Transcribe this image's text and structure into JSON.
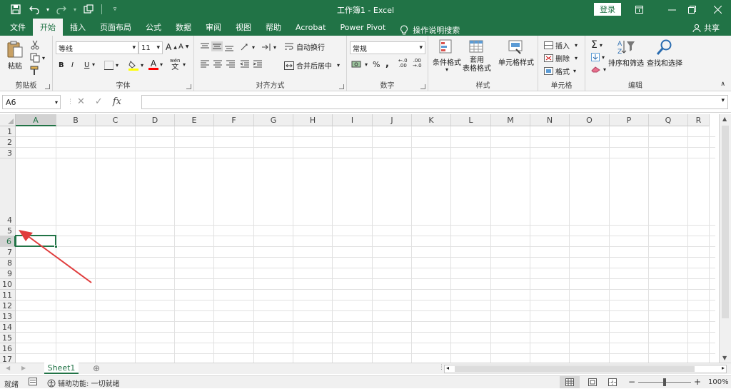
{
  "titlebar": {
    "title": "工作簿1 - Excel",
    "login_label": "登录",
    "bg_color": "#217346"
  },
  "tabs": [
    {
      "label": "文件"
    },
    {
      "label": "开始"
    },
    {
      "label": "插入"
    },
    {
      "label": "页面布局"
    },
    {
      "label": "公式"
    },
    {
      "label": "数据"
    },
    {
      "label": "审阅"
    },
    {
      "label": "视图"
    },
    {
      "label": "帮助"
    },
    {
      "label": "Acrobat"
    },
    {
      "label": "Power Pivot"
    }
  ],
  "tell_me": "操作说明搜索",
  "share_label": "共享",
  "ribbon": {
    "clipboard": {
      "paste": "粘贴",
      "group": "剪贴板"
    },
    "font": {
      "name": "等线",
      "size": "11",
      "group": "字体",
      "bold": "B",
      "italic": "I",
      "underline": "U",
      "font_color": "A",
      "wen": "wén",
      "wen_char": "文"
    },
    "alignment": {
      "wrap": "自动换行",
      "merge": "合并后居中",
      "group": "对齐方式"
    },
    "number": {
      "format": "常规",
      "percent": "%",
      "comma": ",",
      "group": "数字"
    },
    "styles": {
      "conditional": "条件格式",
      "table1": "套用",
      "table2": "表格格式",
      "cell_styles": "单元格样式",
      "group": "样式"
    },
    "cells": {
      "insert": "插入",
      "delete": "删除",
      "format": "格式",
      "group": "单元格"
    },
    "editing": {
      "sort": "排序和筛选",
      "find": "查找和选择",
      "group": "编辑",
      "sigma": "Σ"
    }
  },
  "formula_bar": {
    "name_box": "A6",
    "cancel": "✕",
    "enter": "✓",
    "fx": "fx",
    "value": ""
  },
  "columns": [
    "A",
    "B",
    "C",
    "D",
    "E",
    "F",
    "G",
    "H",
    "I",
    "J",
    "K",
    "L",
    "M",
    "N",
    "O",
    "P",
    "Q",
    "R"
  ],
  "rows": [
    "1",
    "2",
    "3",
    "4",
    "5",
    "6",
    "7",
    "8",
    "9",
    "10",
    "11",
    "12",
    "13",
    "14",
    "15",
    "16",
    "17",
    "18"
  ],
  "selected_cell": "A6",
  "sheet_tabs": [
    {
      "label": "Sheet1"
    }
  ],
  "add_sheet": "⊕",
  "status": {
    "ready": "就绪",
    "accessibility": "辅助功能: 一切就绪",
    "zoom": "100%"
  }
}
